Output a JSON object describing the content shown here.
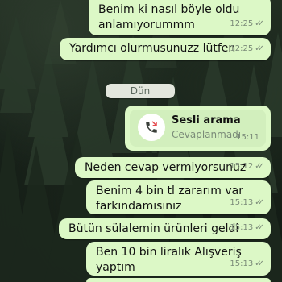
{
  "messages": [
    {
      "text": "Benim ki nasıl böyle oldu\nanlamıyorummm",
      "time": "12:25",
      "ticks": "✓✓"
    },
    {
      "text": "Yardımcı olurmusunuzz lütfen",
      "time": "12:25",
      "ticks": "✓✓"
    },
    {
      "text": "Neden cevap vermiyorsunuz",
      "time": "15:12",
      "ticks": "✓✓"
    },
    {
      "text": "Benim 4 bin tl zararım var\nfarkındamısınız",
      "time": "15:13",
      "ticks": "✓✓"
    },
    {
      "text": "Bütün sülalemin ürünleri geldi",
      "time": "15:13",
      "ticks": "✓✓"
    },
    {
      "text": "Ben 10 bin liralık Alışveriş yaptım",
      "time": "15:13",
      "ticks": "✓✓"
    }
  ],
  "date_separator": "Dün",
  "call": {
    "title": "Sesli arama",
    "status": "Cevaplanmadı",
    "time": "15:11",
    "icon": "missed-call-icon"
  },
  "colors": {
    "outgoing_bubble": "#dcf8c6",
    "meta_text": "#7a8a78",
    "date_chip": "#e3e6dd"
  }
}
